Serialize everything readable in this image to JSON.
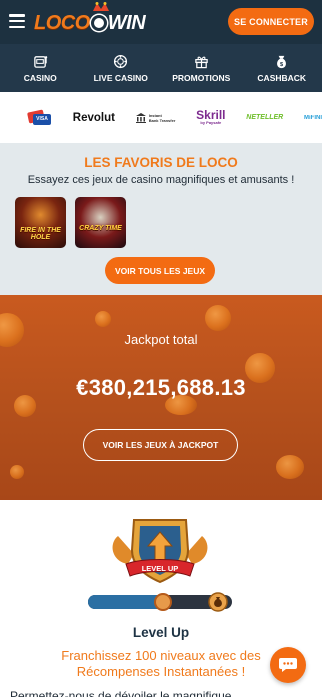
{
  "header": {
    "logo_left": "LOCO",
    "logo_right": "WIN",
    "connect_label": "SE CONNECTER"
  },
  "nav": {
    "items": [
      {
        "label": "CASINO",
        "icon": "slot-machine-icon"
      },
      {
        "label": "LIVE CASINO",
        "icon": "casino-chip-icon"
      },
      {
        "label": "PROMOTIONS",
        "icon": "gift-icon"
      },
      {
        "label": "CASHBACK",
        "icon": "money-bag-icon"
      }
    ]
  },
  "payments": {
    "visa": "VISA",
    "revolut": "Revolut",
    "bank_line1": "Instant",
    "bank_line2": "Bank Transfer",
    "skrill": "Skrill",
    "skrill_sub": "by Paysafe",
    "neteller": "NETELLER",
    "mifinity": "MiFINITY"
  },
  "favorites": {
    "title": "LES FAVORIS DE LOCO",
    "subtitle": "Essayez ces jeux de casino magnifiques et amusants !",
    "games": [
      {
        "label": "FIRE IN THE HOLE"
      },
      {
        "label": "CRAZY TIME"
      }
    ],
    "all_games_label": "VOIR TOUS LES JEUX"
  },
  "jackpot": {
    "label": "Jackpot total",
    "amount": "€380,215,688.13",
    "button_label": "VOIR LES JEUX À JACKPOT"
  },
  "levelup": {
    "badge_text": "LEVEL UP",
    "progress": 0.52,
    "title": "Level Up",
    "description": "Franchissez 100 niveaux avec des Récompenses Instantanées !",
    "cut_text": "Permettez-nous de dévoiler le magnifique"
  },
  "colors": {
    "accent": "#f36b12",
    "header_bg": "#1d3140",
    "nav_bg": "#23384a",
    "jackpot_bg": "#b4501c"
  }
}
